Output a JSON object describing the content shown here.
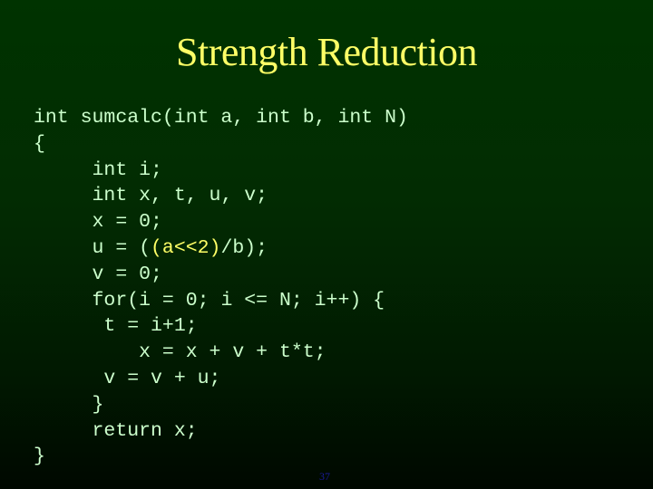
{
  "slide": {
    "title": "Strength Reduction",
    "slide_number": "37",
    "colors": {
      "title": "#ffff66",
      "code": "#ccffcc",
      "highlight": "#ffff66",
      "background_top": "#003300",
      "background_bottom": "#000800",
      "slide_number": "#1a1a99"
    },
    "code_lines": [
      {
        "indent": "",
        "text": "int sumcalc(int a, int b, int N)"
      },
      {
        "indent": "",
        "text": "{"
      },
      {
        "indent": "     ",
        "text": "int i;"
      },
      {
        "indent": "     ",
        "text": "int x, t, u, v;"
      },
      {
        "indent": "     ",
        "text": "x = 0;"
      },
      {
        "indent": "     ",
        "pre": "u = (",
        "hl": "(a<<2)",
        "post": "/b);"
      },
      {
        "indent": "     ",
        "text": "v = 0;"
      },
      {
        "indent": "     ",
        "text": "for(i = 0; i <= N; i++) {"
      },
      {
        "indent": "     ",
        "text": " t = i+1;"
      },
      {
        "indent": "     ",
        "text": "    x = x + v + t*t;"
      },
      {
        "indent": "     ",
        "text": " v = v + u;"
      },
      {
        "indent": "     ",
        "text": "}"
      },
      {
        "indent": "     ",
        "text": "return x;"
      },
      {
        "indent": "",
        "text": "}"
      }
    ]
  }
}
